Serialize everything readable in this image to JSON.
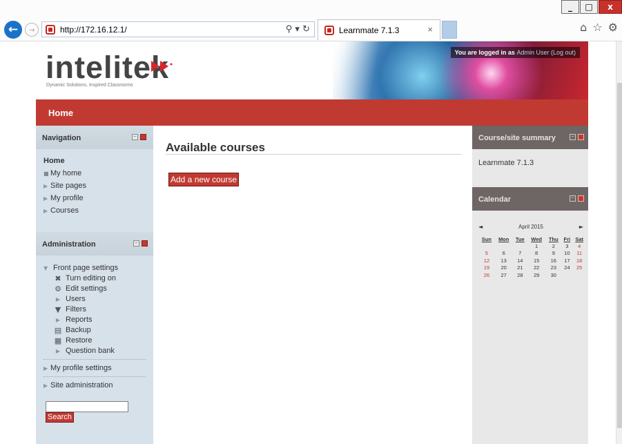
{
  "browser": {
    "url": "http://172.16.12.1/",
    "tab_title": "Learnmate 7.1.3",
    "window_buttons": {
      "minimize": "_",
      "maximize": "□",
      "close": "x"
    }
  },
  "header": {
    "logo_text": "intelitek",
    "tagline": "Dynamic Solutions, Inspired Classrooms",
    "login_prefix": "You are logged in as",
    "login_user": "Admin User",
    "login_logout": "(Log out)"
  },
  "navbar": {
    "home_label": "Home"
  },
  "navigation_block": {
    "title": "Navigation",
    "home": "Home",
    "items": [
      "My home",
      "Site pages",
      "My profile",
      "Courses"
    ]
  },
  "administration_block": {
    "title": "Administration",
    "front_page_settings": "Front page settings",
    "sub_items": [
      "Turn editing on",
      "Edit settings",
      "Users",
      "Filters",
      "Reports",
      "Backup",
      "Restore",
      "Question bank"
    ],
    "my_profile_settings": "My profile settings",
    "site_administration": "Site administration",
    "search_button": "Search"
  },
  "main": {
    "title": "Available courses",
    "add_course_button": "Add a new course"
  },
  "summary_block": {
    "title": "Course/site summary",
    "text": "Learnmate 7.1.3"
  },
  "calendar_block": {
    "title": "Calendar",
    "month": "April 2015",
    "prev": "◄",
    "next": "►",
    "weekdays": [
      "Sun",
      "Mon",
      "Tue",
      "Wed",
      "Thu",
      "Fri",
      "Sat"
    ],
    "weeks": [
      [
        "",
        "",
        "",
        "1",
        "2",
        "3",
        "4"
      ],
      [
        "5",
        "6",
        "7",
        "8",
        "9",
        "10",
        "11"
      ],
      [
        "12",
        "13",
        "14",
        "15",
        "16",
        "17",
        "18"
      ],
      [
        "19",
        "20",
        "21",
        "22",
        "23",
        "24",
        "25"
      ],
      [
        "26",
        "27",
        "28",
        "29",
        "30",
        "",
        ""
      ]
    ]
  },
  "colors": {
    "brand_red": "#c13a32",
    "side_blue": "#d6e1ea",
    "block_grey": "#6e6665"
  }
}
